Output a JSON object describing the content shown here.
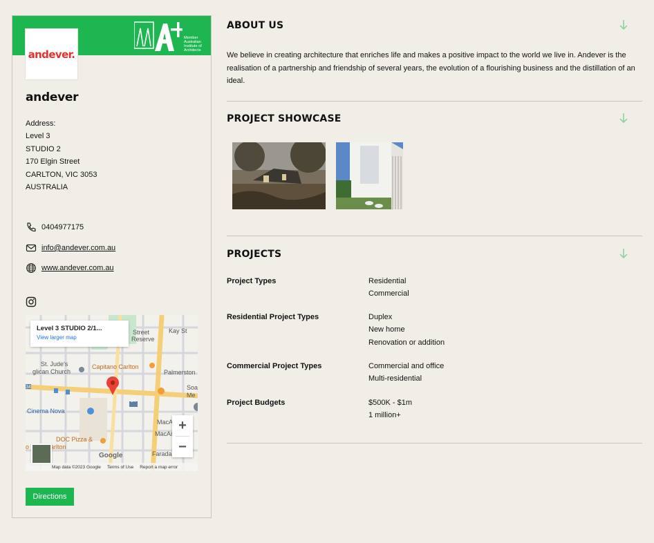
{
  "profile": {
    "logo_text": "andever.",
    "aia_label": "Member Australian Institute of Architects",
    "name": "andever",
    "address_label": "Address:",
    "address_lines": [
      "Level 3",
      "STUDIO 2",
      "170 Elgin Street",
      "CARLTON, VIC 3053",
      "AUSTRALIA"
    ],
    "phone": "0404977175",
    "email": "info@andever.com.au",
    "website": "www.andever.com.au",
    "directions_label": "Directions"
  },
  "map": {
    "popup_title": "Level 3 STUDIO 2/1...",
    "popup_link": "View larger map",
    "labels": {
      "street": "Street",
      "reserve": "Reserve",
      "kay_st": "Kay St",
      "st_judes": "St. Jude's",
      "anglican": "glican Church",
      "capitano": "Capitano Carlton",
      "palmerston": "Palmerston",
      "soa": "Soa",
      "me": "Me",
      "cinema": "Cinema Nova",
      "macar1": "MacA",
      "macar2": "MacAr",
      "doc_pizza": "DOC Pizza &",
      "bar_carlton": "o Bar - Carlton",
      "farada": "Farada",
      "num_34a": "34",
      "num_34b": "34"
    },
    "google": "Google",
    "footer": [
      "Map data ©2023 Google",
      "Terms of Use",
      "Report a map error"
    ],
    "zoom_in": "+",
    "zoom_out": "−"
  },
  "about": {
    "title": "ABOUT US",
    "text": "We believe in creating architecture that enriches life and makes a positive impact to the world we live in. Andever is the realisation of a partnership and friendship of several years, the evolution of a flourishing business and the distillation of an ideal."
  },
  "showcase": {
    "title": "PROJECT SHOWCASE"
  },
  "projects": {
    "title": "PROJECTS",
    "rows": [
      {
        "label": "Project Types",
        "values": [
          "Residential",
          "Commercial"
        ]
      },
      {
        "label": "Residential Project Types",
        "values": [
          "Duplex",
          "New home",
          "Renovation or addition"
        ]
      },
      {
        "label": "Commercial Project Types",
        "values": [
          "Commercial and office",
          "Multi-residential"
        ]
      },
      {
        "label": "Project Budgets",
        "values": [
          "$500K - $1m",
          "1 million+"
        ]
      }
    ]
  },
  "colors": {
    "accent": "#1db650",
    "arrow": "#8fd3a0",
    "background": "#f1eee8",
    "logo_red": "#e8312c"
  }
}
